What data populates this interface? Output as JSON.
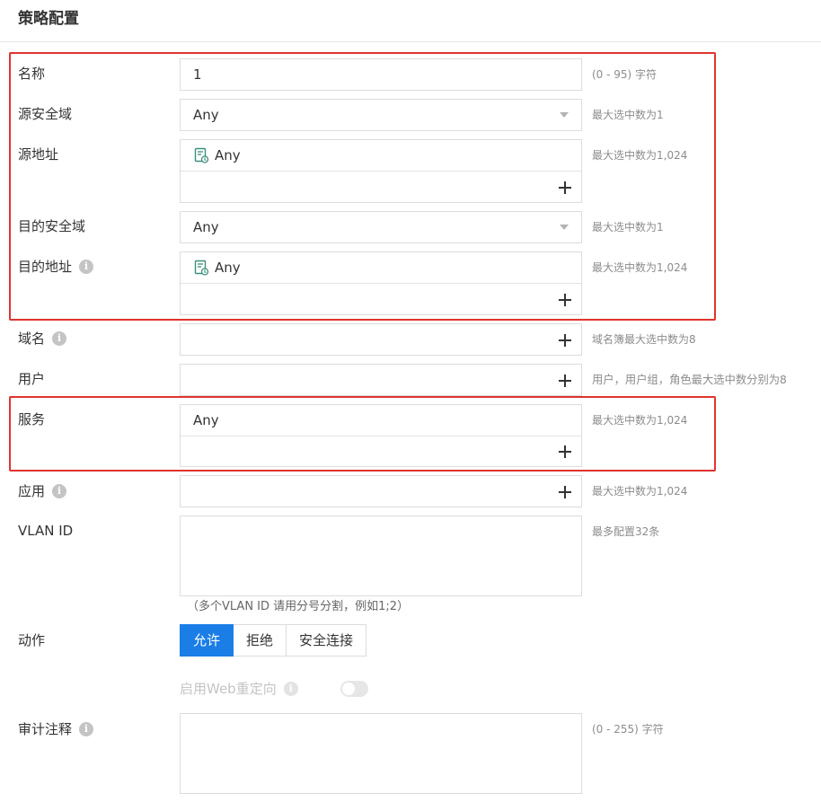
{
  "header": {
    "title": "策略配置"
  },
  "fields": {
    "name": {
      "label": "名称",
      "value": "1",
      "hint": "(0 - 95) 字符"
    },
    "src_zone": {
      "label": "源安全域",
      "value": "Any",
      "hint": "最大选中数为1"
    },
    "src_addr": {
      "label": "源地址",
      "value": "Any",
      "hint": "最大选中数为1,024"
    },
    "dst_zone": {
      "label": "目的安全域",
      "value": "Any",
      "hint": "最大选中数为1"
    },
    "dst_addr": {
      "label": "目的地址",
      "value": "Any",
      "hint": "最大选中数为1,024"
    },
    "domain": {
      "label": "域名",
      "hint": "域名簿最大选中数为8"
    },
    "user": {
      "label": "用户",
      "hint": "用户，用户组，角色最大选中数分别为8"
    },
    "service": {
      "label": "服务",
      "value": "Any",
      "hint": "最大选中数为1,024"
    },
    "app": {
      "label": "应用",
      "hint": "最大选中数为1,024"
    },
    "vlan": {
      "label": "VLAN ID",
      "hint": "最多配置32条",
      "note": "（多个VLAN ID 请用分号分割，例如1;2）"
    },
    "action": {
      "label": "动作",
      "options": [
        "允许",
        "拒绝",
        "安全连接"
      ],
      "selected": "允许"
    },
    "web_redirect": {
      "label": "启用Web重定向",
      "enabled": false
    },
    "audit": {
      "label": "审计注释",
      "hint": "(0 - 255) 字符"
    }
  },
  "icons": {
    "info": "i",
    "address": "address-book-icon"
  },
  "colors": {
    "accent": "#1a7ee6",
    "highlight": "#e0332f"
  }
}
